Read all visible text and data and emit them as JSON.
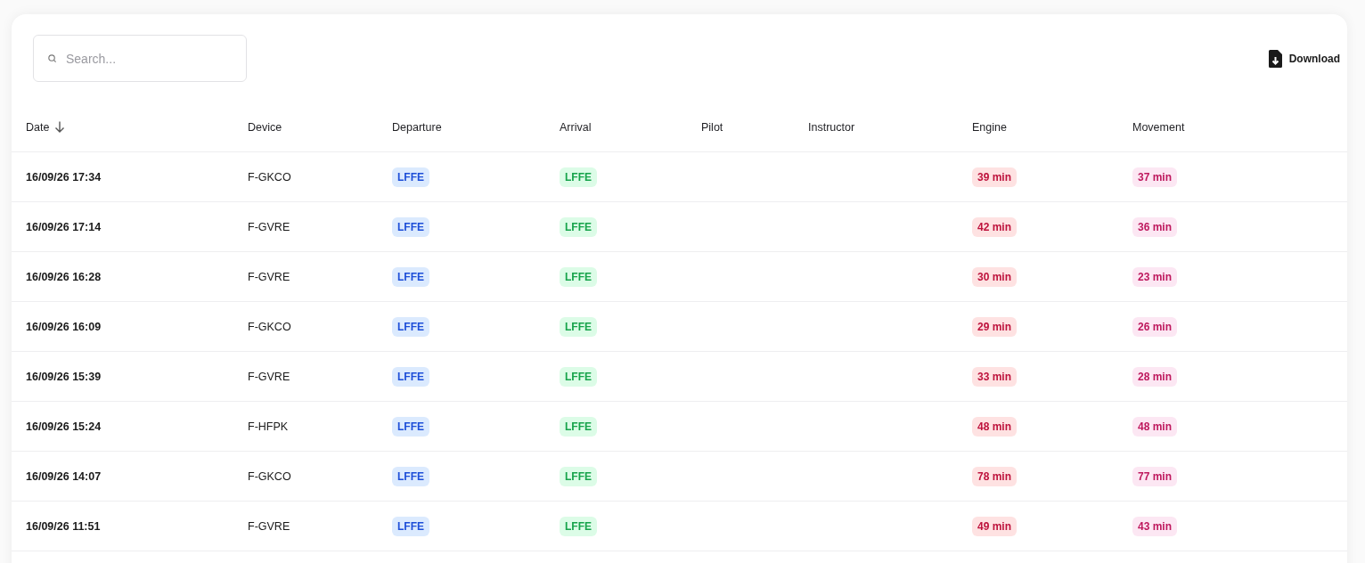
{
  "search": {
    "placeholder": "Search..."
  },
  "download": {
    "label": "Download"
  },
  "table": {
    "columns": [
      {
        "label": "Date",
        "sorted": true
      },
      {
        "label": "Device",
        "sorted": false
      },
      {
        "label": "Departure",
        "sorted": false
      },
      {
        "label": "Arrival",
        "sorted": false
      },
      {
        "label": "Pilot",
        "sorted": false
      },
      {
        "label": "Instructor",
        "sorted": false
      },
      {
        "label": "Engine",
        "sorted": false
      },
      {
        "label": "Movement",
        "sorted": false
      }
    ],
    "rows": [
      {
        "date": "16/09/26 17:34",
        "device": "F-GKCO",
        "departure": "LFFE",
        "arrival": "LFFE",
        "engine": "39 min",
        "movement": "37 min"
      },
      {
        "date": "16/09/26 17:14",
        "device": "F-GVRE",
        "departure": "LFFE",
        "arrival": "LFFE",
        "engine": "42 min",
        "movement": "36 min"
      },
      {
        "date": "16/09/26 16:28",
        "device": "F-GVRE",
        "departure": "LFFE",
        "arrival": "LFFE",
        "engine": "30 min",
        "movement": "23 min"
      },
      {
        "date": "16/09/26 16:09",
        "device": "F-GKCO",
        "departure": "LFFE",
        "arrival": "LFFE",
        "engine": "29 min",
        "movement": "26 min"
      },
      {
        "date": "16/09/26 15:39",
        "device": "F-GVRE",
        "departure": "LFFE",
        "arrival": "LFFE",
        "engine": "33 min",
        "movement": "28 min"
      },
      {
        "date": "16/09/26 15:24",
        "device": "F-HFPK",
        "departure": "LFFE",
        "arrival": "LFFE",
        "engine": "48 min",
        "movement": "48 min"
      },
      {
        "date": "16/09/26 14:07",
        "device": "F-GKCO",
        "departure": "LFFE",
        "arrival": "LFFE",
        "engine": "78 min",
        "movement": "77 min"
      },
      {
        "date": "16/09/26 11:51",
        "device": "F-GVRE",
        "departure": "LFFE",
        "arrival": "LFFE",
        "engine": "49 min",
        "movement": "43 min"
      }
    ]
  }
}
